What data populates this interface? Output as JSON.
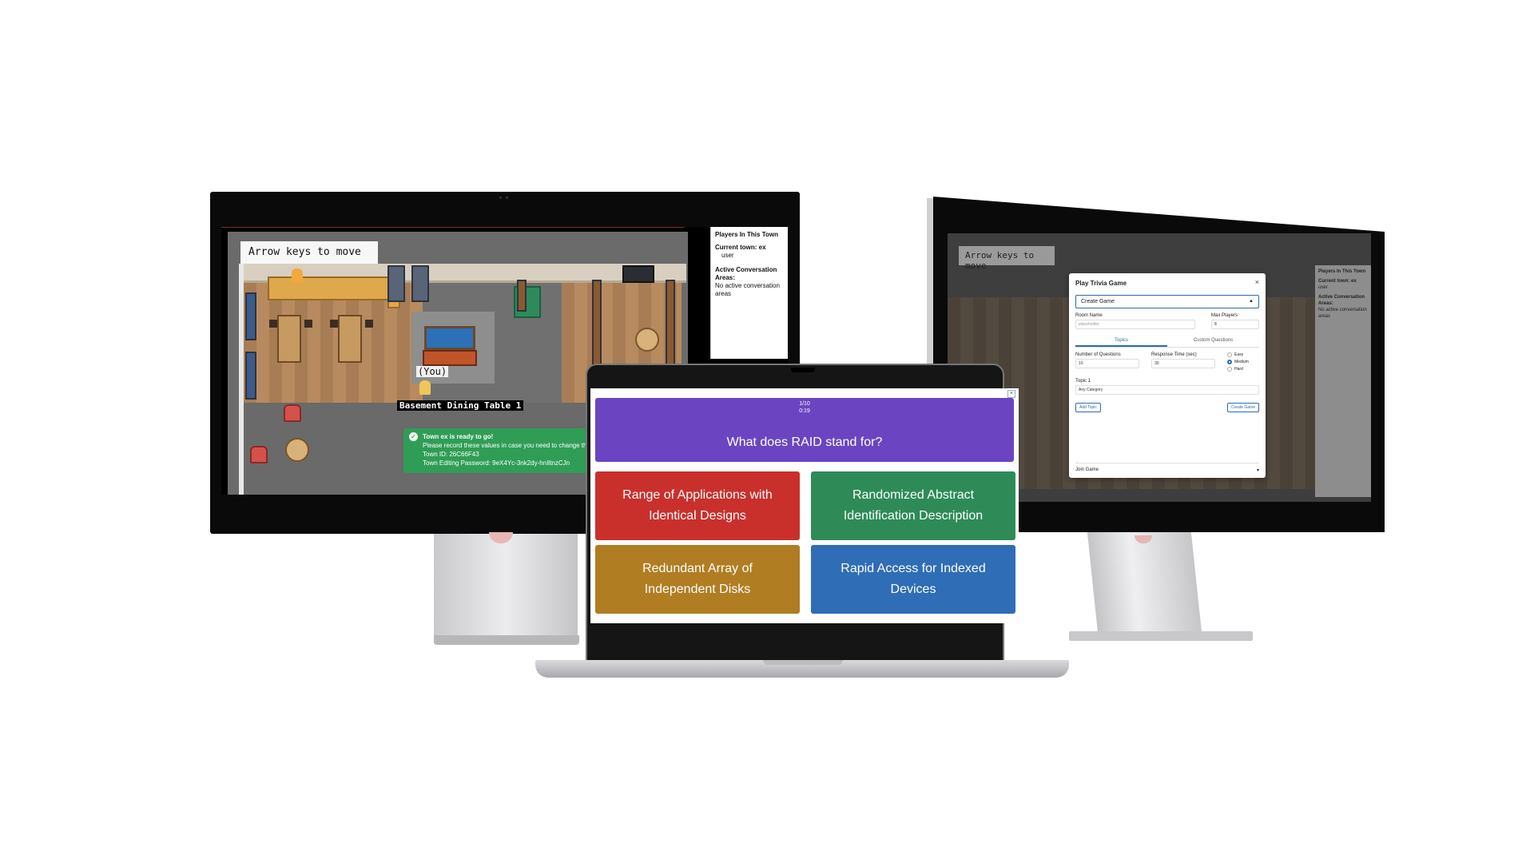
{
  "left_monitor": {
    "banner": "Arrow keys to move",
    "you_label": "(You)",
    "area_label": "Basement Dining Table 1",
    "toast": {
      "title": "Town ex is ready to go!",
      "line1": "Please record these values in case you need to change th",
      "line2": "Town ID: 26C66F43",
      "line3": "Town Editing Password: 9eX4Yc-3nk2dy-hnIltnzCJn"
    },
    "side_panel": {
      "title": "Players In This Town",
      "current_town_label": "Current town: ex",
      "user": "user",
      "conversation_label": "Active Conversation Areas:",
      "conversation_value": "No active conversation areas"
    }
  },
  "right_monitor": {
    "banner": "Arrow keys to move",
    "side_panel": {
      "title": "Players In This Town",
      "current_town_label": "Current town: ex",
      "user": "user",
      "conversation_label": "Active Conversation Areas:",
      "conversation_value": "No active conversation areas"
    },
    "modal": {
      "title": "Play Trivia Game",
      "close": "×",
      "create_section": "Create Game",
      "room_name_label": "Room Name",
      "room_name_placeholder": "placeholder",
      "max_players_label": "Max Players",
      "max_players_value": "8",
      "tab_topics": "Topics",
      "tab_custom": "Custom Questions",
      "num_questions_label": "Number of Questions",
      "num_questions_value": "10",
      "response_time_label": "Response Time (sec)",
      "response_time_value": "30",
      "difficulty": [
        "Easy",
        "Medium",
        "Hard"
      ],
      "difficulty_selected": "Medium",
      "topic_label": "Topic 1",
      "topic_value": "Any Category",
      "add_topic": "Add Topic",
      "create_button": "Create Game",
      "join_section": "Join Game"
    }
  },
  "laptop": {
    "close": "×",
    "question_counter": "1/10",
    "timer": "0:19",
    "question": "What does RAID stand for?",
    "answers": [
      "Range of Applications with Identical Designs",
      "Randomized Abstract Identification Description",
      "Redundant Array of Independent Disks",
      "Rapid Access for Indexed Devices"
    ]
  },
  "colors": {
    "question_purple": "#6b45c1",
    "answer_red": "#c9302c",
    "answer_green": "#2e8b57",
    "answer_gold": "#b07d22",
    "answer_blue": "#2f6db6",
    "toast_green": "#2f9d55",
    "accent_blue": "#2b6cb0"
  }
}
